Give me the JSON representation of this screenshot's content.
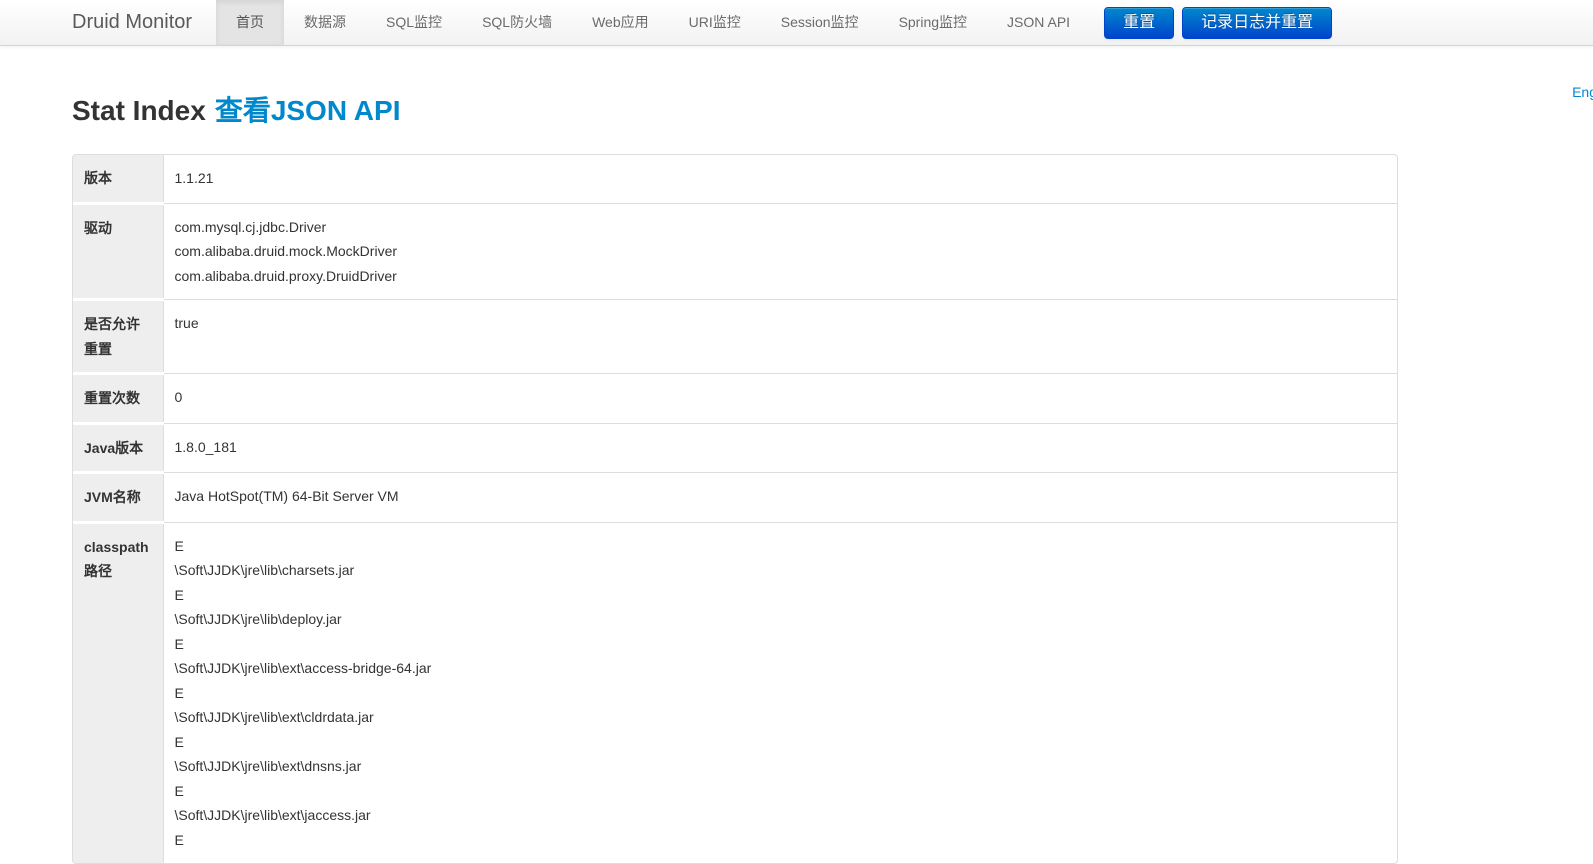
{
  "navbar": {
    "brand": "Druid Monitor",
    "items": [
      {
        "name": "home",
        "label": "首页",
        "active": true
      },
      {
        "name": "datasource",
        "label": "数据源",
        "active": false
      },
      {
        "name": "sql-monitor",
        "label": "SQL监控",
        "active": false
      },
      {
        "name": "sql-firewall",
        "label": "SQL防火墙",
        "active": false
      },
      {
        "name": "web-app",
        "label": "Web应用",
        "active": false
      },
      {
        "name": "uri-monitor",
        "label": "URI监控",
        "active": false
      },
      {
        "name": "session-monitor",
        "label": "Session监控",
        "active": false
      },
      {
        "name": "spring-monitor",
        "label": "Spring监控",
        "active": false
      },
      {
        "name": "json-api",
        "label": "JSON API",
        "active": false
      }
    ],
    "buttons": [
      {
        "name": "reset-button",
        "label": "重置"
      },
      {
        "name": "log-and-reset-button",
        "label": "记录日志并重置"
      }
    ]
  },
  "lang_link": "Eng",
  "page": {
    "title": "Stat Index",
    "title_link": "查看JSON API"
  },
  "stat_table": {
    "rows": [
      {
        "label": "版本",
        "values": [
          "1.1.21"
        ]
      },
      {
        "label": "驱动",
        "values": [
          "com.mysql.cj.jdbc.Driver",
          "com.alibaba.druid.mock.MockDriver",
          "com.alibaba.druid.proxy.DruidDriver"
        ]
      },
      {
        "label": "是否允许重置",
        "values": [
          "true"
        ]
      },
      {
        "label": "重置次数",
        "values": [
          "0"
        ]
      },
      {
        "label": "Java版本",
        "values": [
          "1.8.0_181"
        ]
      },
      {
        "label": "JVM名称",
        "values": [
          "Java HotSpot(TM) 64-Bit Server VM"
        ]
      },
      {
        "label": "classpath路径",
        "values": [
          "E",
          "\\Soft\\JJDK\\jre\\lib\\charsets.jar",
          "E",
          "\\Soft\\JJDK\\jre\\lib\\deploy.jar",
          "E",
          "\\Soft\\JJDK\\jre\\lib\\ext\\access-bridge-64.jar",
          "E",
          "\\Soft\\JJDK\\jre\\lib\\ext\\cldrdata.jar",
          "E",
          "\\Soft\\JJDK\\jre\\lib\\ext\\dnsns.jar",
          "E",
          "\\Soft\\JJDK\\jre\\lib\\ext\\jaccess.jar",
          "E"
        ]
      }
    ]
  },
  "colors": {
    "accent_link": "#0088cc",
    "button_gradient_top": "#0088cc",
    "button_gradient_bottom": "#0044cc",
    "navbar_border": "#d4d4d4",
    "table_label_bg": "#eeeeee",
    "table_border": "#dddddd"
  }
}
